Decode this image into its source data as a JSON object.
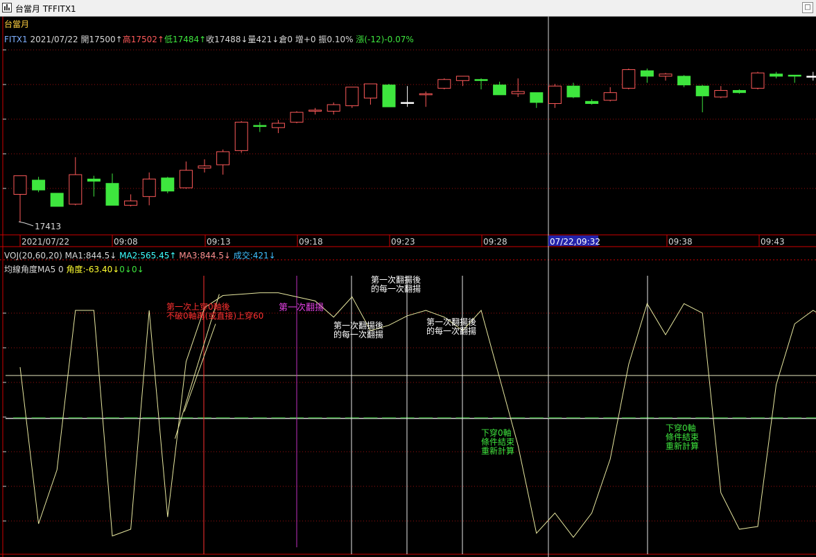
{
  "window": {
    "title": "台當月 TFFITX1",
    "icon": "chart-app-icon",
    "close_glyph": "□"
  },
  "colors": {
    "up": "#ff5a5a",
    "down": "#3ee63e",
    "neutral": "#ffffff",
    "label_white": "#d8d8d8",
    "axis_red": "#d00000",
    "grid": "#a01010",
    "ma_line": "#e8e8a0",
    "zero_line": "#ffffff",
    "yellow": "#ffff30",
    "magenta": "#e040e0",
    "cyan": "#40ffff",
    "cursor_bg": "#2222aa",
    "vline_red": "#ff3030",
    "vline_magenta": "#c030c0"
  },
  "panel_title": "台當月",
  "quote_bar": {
    "symbol": "FITX1",
    "date": "2021/07/22",
    "open": "開17500↑",
    "high": "高17502↑",
    "low": "低17484↑",
    "close": "收17488↓",
    "volume": "量421↓",
    "oi": "倉0",
    "oi_change": "增+0",
    "amplitude": "振0.10%",
    "change": "漲(-12)-0.07%"
  },
  "low_marker": "17413",
  "time_axis": {
    "labels": [
      "2021/07/22",
      "09:08",
      "09:13",
      "09:18",
      "09:23",
      "09:28",
      "09:38",
      "09:43"
    ],
    "cursor_label": "07/22,09:32"
  },
  "indicator_bar": {
    "name": "VOJ(20,60,20)",
    "ma1": "MA1:844.5↓",
    "ma2": "MA2:565.45↑",
    "ma3": "MA3:844.5↓",
    "vol": "成交:421↓"
  },
  "angle_bar": {
    "name": "均線角度MA5 0",
    "angle": "角度:-63.40↓",
    "v1": "0↓",
    "v2": "0↓"
  },
  "annotations": {
    "first_cross_line1": "第一次上穿0軸後",
    "first_cross_line2": "不破0軸再(或直接)上穿60",
    "first_flip": "第一次翻揚",
    "each_flip_1_line1": "第一次翻揚後",
    "each_flip_1_line2": "的每一次翻揚",
    "each_flip_2_line1": "第一次翻揚後",
    "each_flip_2_line2": "的每一次翻揚",
    "each_flip_3_line1": "第一次翻揚後",
    "each_flip_3_line2": "的每一次翻揚",
    "reset_1_line1": "下穿0軸",
    "reset_1_line2": "條件結束",
    "reset_1_line3": "重新計算",
    "reset_2_line1": "下穿0軸",
    "reset_2_line2": "條件結束",
    "reset_2_line3": "重新計算"
  },
  "candles": [
    {
      "o": 17438,
      "h": 17455,
      "l": 17413,
      "c": 17455
    },
    {
      "o": 17451,
      "h": 17454,
      "l": 17440,
      "c": 17442
    },
    {
      "o": 17439,
      "h": 17439,
      "l": 17427,
      "c": 17427
    },
    {
      "o": 17429,
      "h": 17472,
      "l": 17428,
      "c": 17456
    },
    {
      "o": 17452,
      "h": 17455,
      "l": 17436,
      "c": 17450
    },
    {
      "o": 17448,
      "h": 17457,
      "l": 17428,
      "c": 17428
    },
    {
      "o": 17428,
      "h": 17438,
      "l": 17427,
      "c": 17432
    },
    {
      "o": 17436,
      "h": 17458,
      "l": 17428,
      "c": 17452
    },
    {
      "o": 17453,
      "h": 17454,
      "l": 17439,
      "c": 17441
    },
    {
      "o": 17444,
      "h": 17468,
      "l": 17443,
      "c": 17460
    },
    {
      "o": 17462,
      "h": 17470,
      "l": 17458,
      "c": 17464
    },
    {
      "o": 17465,
      "h": 17479,
      "l": 17456,
      "c": 17477
    },
    {
      "o": 17478,
      "h": 17505,
      "l": 17476,
      "c": 17504
    },
    {
      "o": 17501,
      "h": 17504,
      "l": 17495,
      "c": 17500
    },
    {
      "o": 17499,
      "h": 17506,
      "l": 17494,
      "c": 17503
    },
    {
      "o": 17504,
      "h": 17514,
      "l": 17503,
      "c": 17513
    },
    {
      "o": 17514,
      "h": 17517,
      "l": 17511,
      "c": 17515
    },
    {
      "o": 17514,
      "h": 17522,
      "l": 17511,
      "c": 17520
    },
    {
      "o": 17519,
      "h": 17529,
      "l": 17517,
      "c": 17536
    },
    {
      "o": 17526,
      "h": 17539,
      "l": 17520,
      "c": 17539
    },
    {
      "o": 17538,
      "h": 17539,
      "l": 17518,
      "c": 17518
    },
    {
      "o": 17522,
      "h": 17537,
      "l": 17518,
      "c": 17522
    },
    {
      "o": 17529,
      "h": 17532,
      "l": 17518,
      "c": 17530
    },
    {
      "o": 17535,
      "h": 17544,
      "l": 17534,
      "c": 17543
    },
    {
      "o": 17542,
      "h": 17546,
      "l": 17537,
      "c": 17546
    },
    {
      "o": 17543,
      "h": 17544,
      "l": 17534,
      "c": 17542
    },
    {
      "o": 17538,
      "h": 17541,
      "l": 17529,
      "c": 17529
    },
    {
      "o": 17530,
      "h": 17544,
      "l": 17527,
      "c": 17532
    },
    {
      "o": 17531,
      "h": 17531,
      "l": 17517,
      "c": 17522
    },
    {
      "o": 17521,
      "h": 17539,
      "l": 17517,
      "c": 17537
    },
    {
      "o": 17537,
      "h": 17540,
      "l": 17526,
      "c": 17527
    },
    {
      "o": 17523,
      "h": 17525,
      "l": 17520,
      "c": 17521
    },
    {
      "o": 17524,
      "h": 17536,
      "l": 17523,
      "c": 17531
    },
    {
      "o": 17535,
      "h": 17553,
      "l": 17534,
      "c": 17552
    },
    {
      "o": 17551,
      "h": 17553,
      "l": 17540,
      "c": 17546
    },
    {
      "o": 17546,
      "h": 17549,
      "l": 17542,
      "c": 17548
    },
    {
      "o": 17546,
      "h": 17547,
      "l": 17536,
      "c": 17538
    },
    {
      "o": 17537,
      "h": 17538,
      "l": 17513,
      "c": 17528
    },
    {
      "o": 17527,
      "h": 17537,
      "l": 17526,
      "c": 17533
    },
    {
      "o": 17533,
      "h": 17534,
      "l": 17530,
      "c": 17531
    },
    {
      "o": 17535,
      "h": 17550,
      "l": 17534,
      "c": 17549
    },
    {
      "o": 17548,
      "h": 17550,
      "l": 17544,
      "c": 17546
    },
    {
      "o": 17547,
      "h": 17547,
      "l": 17540,
      "c": 17546
    },
    {
      "o": 17546,
      "h": 17550,
      "l": 17542,
      "c": 17546
    },
    {
      "o": 17544,
      "h": 17548,
      "l": 17542,
      "c": 17544
    }
  ],
  "angle_series": [
    38,
    -78,
    -38,
    80,
    80,
    -87,
    -82,
    80,
    -73,
    42,
    82,
    91,
    92,
    93,
    93,
    90,
    87,
    75,
    90,
    65,
    69,
    76,
    80,
    75,
    65,
    80,
    30,
    -20,
    -85,
    -70,
    -88,
    -70,
    -30,
    40,
    85,
    62,
    85,
    78,
    -55,
    -82,
    -80,
    25,
    70,
    80,
    72,
    75
  ],
  "extra_segments": [
    {
      "from_index": 8.4,
      "from_value": -15,
      "to_index": 10.8,
      "to_value": 92
    },
    {
      "from_index": 8.9,
      "from_value": 5,
      "to_index": 10.6,
      "to_value": 70
    }
  ]
}
